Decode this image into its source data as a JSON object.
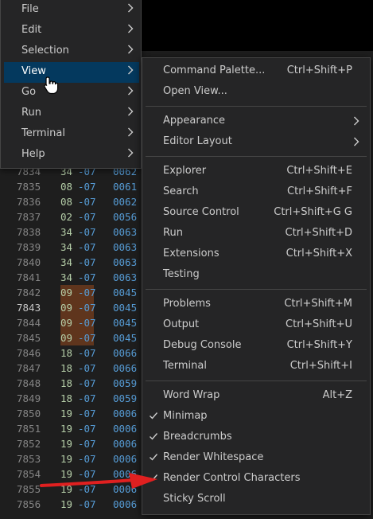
{
  "colors": {
    "menu_bg": "#252526",
    "menu_border": "#454545",
    "active_bg": "#04395e",
    "text": "#cccccc",
    "line_number": "#858585",
    "hex_value": "#569cd6",
    "annotation_arrow": "#e02020"
  },
  "editor": {
    "lines": [
      {
        "num": "7834",
        "frag": "34",
        "ofs": "-07",
        "val": "0062"
      },
      {
        "num": "7835",
        "frag": "08",
        "ofs": "-07",
        "val": "0061"
      },
      {
        "num": "7836",
        "frag": "08",
        "ofs": "-07",
        "val": "0062"
      },
      {
        "num": "7837",
        "frag": "02",
        "ofs": "-07",
        "val": "0056"
      },
      {
        "num": "7838",
        "frag": "34",
        "ofs": "-07",
        "val": "0063"
      },
      {
        "num": "7839",
        "frag": "34",
        "ofs": "-07",
        "val": "0063"
      },
      {
        "num": "7840",
        "frag": "34",
        "ofs": "-07",
        "val": "0063"
      },
      {
        "num": "7841",
        "frag": "34",
        "ofs": "-07",
        "val": "0063"
      },
      {
        "num": "7842",
        "frag": "09",
        "ofs": "-07",
        "val": "0045",
        "highlight": true
      },
      {
        "num": "7843",
        "frag": "09",
        "ofs": "-07",
        "val": "0045",
        "highlight": true,
        "current": true
      },
      {
        "num": "7844",
        "frag": "09",
        "ofs": "-07",
        "val": "0045",
        "highlight": true
      },
      {
        "num": "7845",
        "frag": "09",
        "ofs": "-07",
        "val": "0045",
        "highlight": true
      },
      {
        "num": "7846",
        "frag": "18",
        "ofs": "-07",
        "val": "0066"
      },
      {
        "num": "7847",
        "frag": "18",
        "ofs": "-07",
        "val": "0066"
      },
      {
        "num": "7848",
        "frag": "18",
        "ofs": "-07",
        "val": "0059"
      },
      {
        "num": "7849",
        "frag": "18",
        "ofs": "-07",
        "val": "0059"
      },
      {
        "num": "7850",
        "frag": "19",
        "ofs": "-07",
        "val": "0006"
      },
      {
        "num": "7851",
        "frag": "19",
        "ofs": "-07",
        "val": "0006"
      },
      {
        "num": "7852",
        "frag": "19",
        "ofs": "-07",
        "val": "0006"
      },
      {
        "num": "7853",
        "frag": "19",
        "ofs": "-07",
        "val": "0006"
      },
      {
        "num": "7854",
        "frag": "19",
        "ofs": "-07",
        "val": "0006"
      },
      {
        "num": "7855",
        "frag": "19",
        "ofs": "-07",
        "val": "0006"
      },
      {
        "num": "7856",
        "frag": "19",
        "ofs": "-07",
        "val": "0006"
      }
    ]
  },
  "main_menu": {
    "items": [
      {
        "label": "File",
        "icon": "chevron-right-icon"
      },
      {
        "label": "Edit",
        "icon": "chevron-right-icon"
      },
      {
        "label": "Selection",
        "icon": "chevron-right-icon"
      },
      {
        "label": "View",
        "icon": "chevron-right-icon",
        "active": true
      },
      {
        "label": "Go",
        "icon": "chevron-right-icon"
      },
      {
        "label": "Run",
        "icon": "chevron-right-icon"
      },
      {
        "label": "Terminal",
        "icon": "chevron-right-icon"
      },
      {
        "label": "Help",
        "icon": "chevron-right-icon"
      }
    ]
  },
  "view_menu": {
    "groups": [
      [
        {
          "label": "Command Palette...",
          "shortcut": "Ctrl+Shift+P"
        },
        {
          "label": "Open View...",
          "shortcut": ""
        }
      ],
      [
        {
          "label": "Appearance",
          "submenu": true
        },
        {
          "label": "Editor Layout",
          "submenu": true
        }
      ],
      [
        {
          "label": "Explorer",
          "shortcut": "Ctrl+Shift+E"
        },
        {
          "label": "Search",
          "shortcut": "Ctrl+Shift+F"
        },
        {
          "label": "Source Control",
          "shortcut": "Ctrl+Shift+G G"
        },
        {
          "label": "Run",
          "shortcut": "Ctrl+Shift+D"
        },
        {
          "label": "Extensions",
          "shortcut": "Ctrl+Shift+X"
        },
        {
          "label": "Testing",
          "shortcut": ""
        }
      ],
      [
        {
          "label": "Problems",
          "shortcut": "Ctrl+Shift+M"
        },
        {
          "label": "Output",
          "shortcut": "Ctrl+Shift+U"
        },
        {
          "label": "Debug Console",
          "shortcut": "Ctrl+Shift+Y"
        },
        {
          "label": "Terminal",
          "shortcut": "Ctrl+Shift+I"
        }
      ],
      [
        {
          "label": "Word Wrap",
          "shortcut": "Alt+Z",
          "checked": false
        },
        {
          "label": "Minimap",
          "shortcut": "",
          "checked": true
        },
        {
          "label": "Breadcrumbs",
          "shortcut": "",
          "checked": true
        },
        {
          "label": "Render Whitespace",
          "shortcut": "",
          "checked": true
        },
        {
          "label": "Render Control Characters",
          "shortcut": "",
          "checked": true
        },
        {
          "label": "Sticky Scroll",
          "shortcut": "",
          "checked": false
        }
      ]
    ]
  }
}
